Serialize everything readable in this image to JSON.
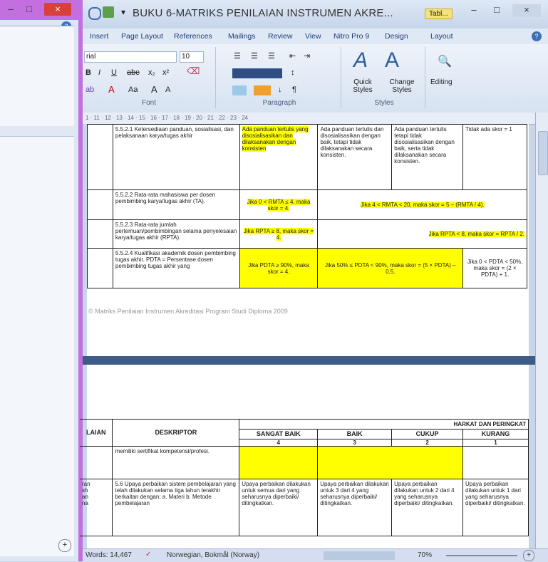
{
  "left_window": {
    "min_label": "–",
    "max_label": "□",
    "close_label": "×",
    "ribbon_help": "?"
  },
  "titlebar": {
    "title": "BUKU 6-MATRIKS PENILAIAN INSTRUMEN AKRE...",
    "context_tab": "Tabl...",
    "min": "–",
    "max": "□",
    "close": "×"
  },
  "tabs": [
    "Insert",
    "Page Layout",
    "References",
    "Mailings",
    "Review",
    "View",
    "Nitro Pro 9",
    "Design",
    "Layout"
  ],
  "ribbon": {
    "font_name": "rial",
    "font_size": "10",
    "font_label": "Font",
    "paragraph_label": "Paragraph",
    "styles_label": "Styles",
    "quick_styles": "Quick Styles",
    "change_styles": "Change Styles",
    "editing": "Editing",
    "grow_font": "A",
    "shrink_font": "A",
    "aa": "Aa"
  },
  "ruler_text": "1 · 11 · 12 · 13 · 14 · 15 · 16 · 17 · 18 · 19 · 20 · 21 · 22 · 23 · 24",
  "upper_table": {
    "rows": [
      {
        "descriptor": "5.5.2.1 Ketersediaan panduan, sosialisasi, dan pelaksanaan karya/tugas akhir",
        "c4": "Ada panduan tertulis yang disosialisasikan dan dilaksanakan dengan konsisten",
        "c3": "Ada panduan tertulis dan disosialisasikan dengan baik, tetapi tidak dilaksanakan secara konsisten.",
        "c2": "Ada panduan tertulis tetapi tidak disosialisasikan dengan baik, serta tidak dilaksanakan secara konsisten.",
        "c1": "Tidak ada skor = 1"
      },
      {
        "descriptor": "5.5.2.2 Rata-rata mahasiswa per dosen pembimbing karya/tugas akhir (TA).",
        "c4": "Jika 0 < RMTA ≤ 4, maka skor = 4.",
        "c321": "Jika 4 < RMTA < 20, maka skor = 5 – (RMTA / 4)."
      },
      {
        "descriptor": "5.5.2.3 Rata-rata jumlah pertemuan/pembimbingan selama penyelesaian karya/tugas akhir (RPTA).",
        "c4": "Jika RPTA ≥ 8, maka skor = 4.",
        "c321": "Jika RPTA < 8, maka skor = RPTA / 2."
      },
      {
        "descriptor": "5.5.2.4 Kualifikasi akademik dosen pembimbing tugas akhir. PDTA = Persentase dosen pembimbing tugas akhir yang",
        "c4": "Jika PDTA ≥ 90%, maka skor = 4.",
        "c32": "Jika 50% ≤ PDTA < 90%, maka skor = (5 × PDTA) – 0.5.",
        "c1": "Jika 0 < PDTA < 50%, maka skor = (2 × PDTA) + 1."
      }
    ]
  },
  "footer_note": "© Matriks Penilaian Instrumen Akreditasi Program Studi Diploma 2009",
  "lower_table": {
    "col_left_header": "LAIAN",
    "descriptor_header": "DESKRIPTOR",
    "group_header": "HARKAT DAN PERINGKAT",
    "grades": [
      "SANGAT BAIK",
      "BAIK",
      "CUKUP",
      "KURANG"
    ],
    "scores": [
      "4",
      "3",
      "2",
      "1"
    ],
    "row1_descriptor": "memiliki sertifikat kompetensi/profesi.",
    "row2_left": "ran\nsh\nan\nna",
    "row2_descriptor": "5.6 Upaya perbaikan sistem pembelajaran yang telah dilakukan selama tiga tahun terakhir berkaitan dengan: a. Materi b. Metode pembelajaran",
    "row2_cells": [
      "Upaya perbaikan dilakukan untuk semua dari yang seharusnya diperbaiki/ ditingkatkan.",
      "Upaya perbaikan dilakukan untuk 3 dari 4 yang seharusnya diperbaiki/ ditingkatkan.",
      "Upaya perbaikan dilakukan untuk 2 dari 4 yang seharusnya diperbaiki/ ditingkatkan.",
      "Upaya perbaikan dilakukan untuk 1 dari yang seharusnya diperbaiki/ ditingkatkan."
    ]
  },
  "statusbar": {
    "words": "Words: 14,467",
    "language": "Norwegian, Bokmål (Norway)",
    "zoom": "70%"
  },
  "colors": {
    "accent_purple": "#c36fe0",
    "highlight": "#ffff00",
    "ribbon": "#dfe8f5"
  }
}
